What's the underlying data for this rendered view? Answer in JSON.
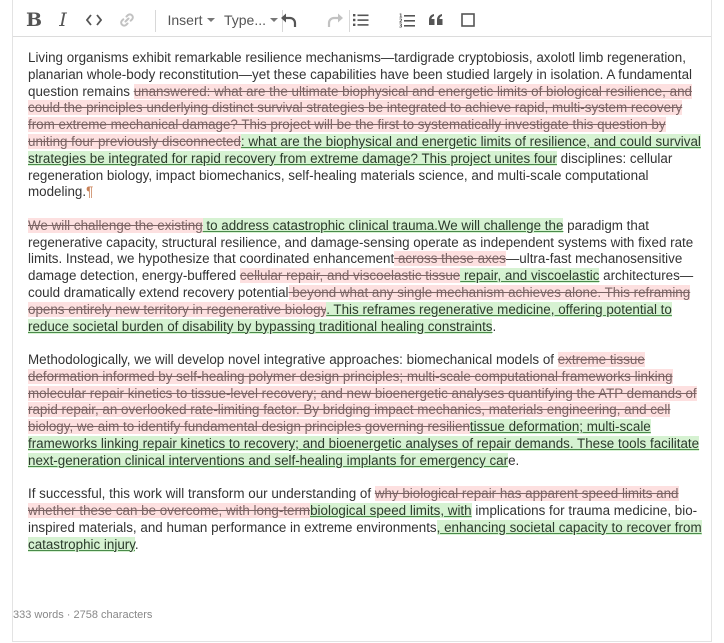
{
  "toolbar": {
    "bold_label": "B",
    "italic_label": "I",
    "insert_label": "Insert",
    "type_label": "Type..."
  },
  "doc": {
    "p1": [
      {
        "t": "n",
        "x": "Living organisms exhibit remarkable resilience mechanisms—tardigrade cryptobiosis, axolotl limb regeneration, planarian whole-body reconstitution—yet these capabilities have been studied largely in isolation. A fundamental question remains "
      },
      {
        "t": "d",
        "x": "unanswered: what are the ultimate biophysical and energetic limits of biological resilience, and could the principles underlying distinct survival strategies be integrated to achieve rapid, multi-system recovery from extreme mechanical damage? This project will be the first to systematically investigate this question by uniting four previously disconnected"
      },
      {
        "t": "i",
        "x": ": what are the biophysical and energetic limits of resilience, and could survival strategies be integrated for rapid recovery from extreme damage? This project unites four"
      },
      {
        "t": "n",
        "x": " disciplines: cellular regeneration biology, impact biomechanics, self-healing materials science, and multi-scale computational modeling."
      },
      {
        "t": "p",
        "x": "¶"
      }
    ],
    "p2": [
      {
        "t": "d",
        "x": "We will challenge the existing"
      },
      {
        "t": "i",
        "x": "  to address catastrophic clinical trauma.We will challenge the"
      },
      {
        "t": "n",
        "x": " paradigm that regenerative capacity, structural resilience, and damage-sensing operate as independent systems with fixed rate limits. Instead, we hypothesize that coordinated enhancement"
      },
      {
        "t": "d",
        "x": " across these axes"
      },
      {
        "t": "n",
        "x": "—ultra-fast mechanosensitive damage detection, energy-buffered "
      },
      {
        "t": "d",
        "x": " cellular repair, and viscoelastic tissue"
      },
      {
        "t": "i",
        "x": " repair, and viscoelastic"
      },
      {
        "t": "n",
        "x": " architectures—could dramatically extend recovery potential"
      },
      {
        "t": "d",
        "x": " beyond what any single mechanism achieves alone. This reframing opens entirely new territory in regenerative biology"
      },
      {
        "t": "i",
        "x": ". This reframes regenerative medicine, offering potential to reduce societal burden of disability by bypassing traditional healing constraints"
      },
      {
        "t": "n",
        "x": "."
      }
    ],
    "p3": [
      {
        "t": "n",
        "x": "Methodologically, we will develop novel integrative approaches: biomechanical models of "
      },
      {
        "t": "d",
        "x": "extreme tissue deformation informed by self-healing polymer design principles; multi-scale computational frameworks linking molecular repair kinetics to tissue-level recovery; and new bioenergetic analyses quantifying the ATP demands of rapid repair, an overlooked rate-limiting factor. By bridging impact mechanics, materials engineering, and cell biology, we aim to identify fundamental design principles governing resilien"
      },
      {
        "t": "i",
        "x": "tissue deformation; multi-scale frameworks linking repair kinetics to recovery; and bioenergetic analyses of repair demands. These tools facilitate next-generation clinical interventions and self-healing implants for emergency car"
      },
      {
        "t": "n",
        "x": "e."
      }
    ],
    "p4": [
      {
        "t": "n",
        "x": "If successful, this work will transform our understanding of "
      },
      {
        "t": "d",
        "x": "why biological repair has apparent speed limits and whether these can be overcome, with long-term"
      },
      {
        "t": "i",
        "x": "biological speed limits, with"
      },
      {
        "t": "n",
        "x": " implications for trauma medicine, bio-inspired materials, and human performance in extreme environments"
      },
      {
        "t": "i",
        "x": ", enhancing societal capacity to recover from catastrophic injury"
      },
      {
        "t": "n",
        "x": "."
      }
    ]
  },
  "footer": {
    "stats": "333 words · 2758 characters"
  }
}
